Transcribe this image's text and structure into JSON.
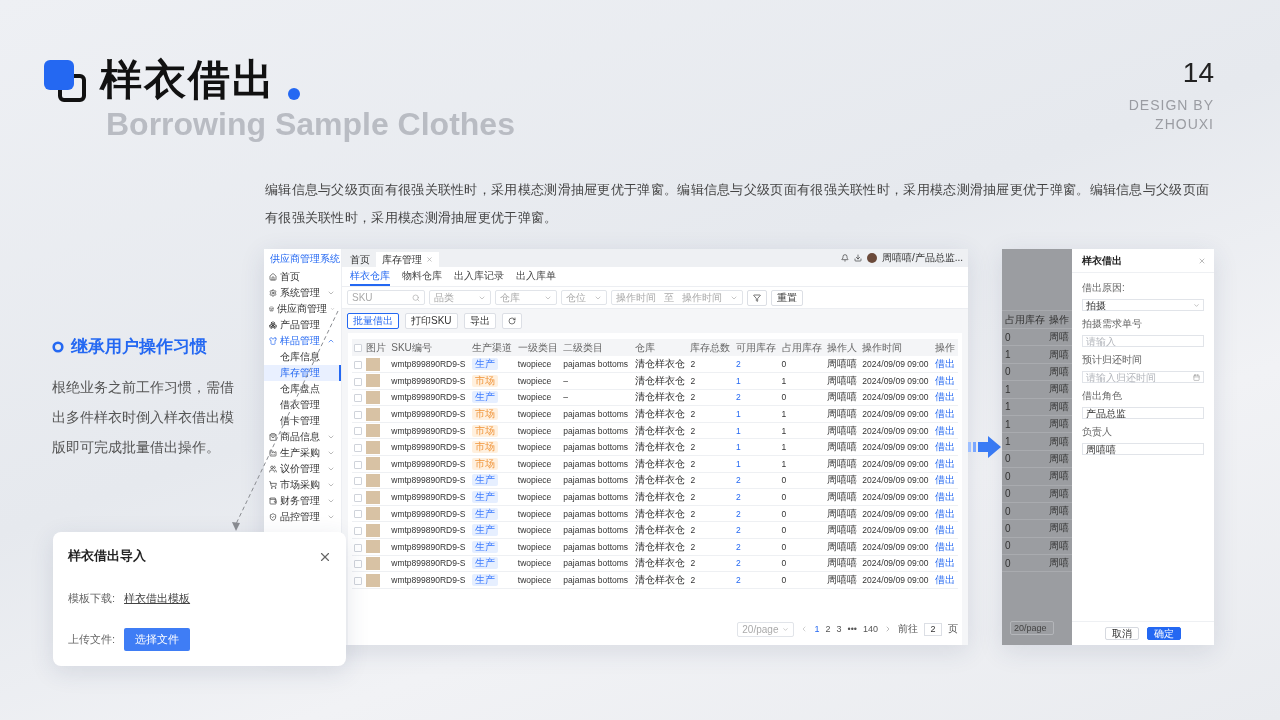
{
  "title": "样衣借出",
  "subtitle": "Borrowing Sample Clothes",
  "page_number": "14",
  "credit": [
    "DESIGN BY",
    "ZHOUXI"
  ],
  "description": "编辑信息与父级页面有很强关联性时，采用模态测滑抽屉更优于弹窗。编辑信息与父级页面有很强关联性时，采用模态测滑抽屉更优于弹窗。编辑信息与父级页面有很强关联性时，采用模态测滑抽屉更优于弹窗。",
  "feature": {
    "heading": "继承用户操作习惯",
    "text": "根绝业务之前工作习惯，需借出多件样衣时倒入样衣借出模版即可完成批量借出操作。"
  },
  "app": {
    "brand": "供应商管理系统",
    "sidebar": {
      "items": [
        {
          "label": "首页",
          "selected": false,
          "kind": "link"
        },
        {
          "label": "系统管理",
          "selected": false,
          "kind": "group",
          "expanded": false
        },
        {
          "label": "供应商管理",
          "selected": false,
          "kind": "group",
          "expanded": false
        },
        {
          "label": "产品管理",
          "selected": false,
          "kind": "link"
        },
        {
          "label": "样品管理",
          "selected": false,
          "kind": "group",
          "expanded": true,
          "children": [
            {
              "label": "仓库信息",
              "selected": false
            },
            {
              "label": "库存管理",
              "selected": true
            },
            {
              "label": "仓库盘点",
              "selected": false
            },
            {
              "label": "借衣管理",
              "selected": false
            },
            {
              "label": "借卡管理",
              "selected": false
            }
          ]
        },
        {
          "label": "商品信息",
          "selected": false,
          "kind": "group",
          "expanded": false
        },
        {
          "label": "生产采购",
          "selected": false,
          "kind": "group",
          "expanded": false
        },
        {
          "label": "议价管理",
          "selected": false,
          "kind": "group",
          "expanded": false
        },
        {
          "label": "市场采购",
          "selected": false,
          "kind": "group",
          "expanded": false
        },
        {
          "label": "财务管理",
          "selected": false,
          "kind": "group",
          "expanded": false
        },
        {
          "label": "品控管理",
          "selected": false,
          "kind": "group",
          "expanded": false
        }
      ]
    },
    "page_tabs": [
      {
        "label": "首页",
        "selected": false,
        "closable": false
      },
      {
        "label": "库存管理",
        "selected": true,
        "closable": true
      }
    ],
    "user": "周嘻嘻/产品总监...",
    "sub_tabs": [
      {
        "label": "样衣仓库",
        "selected": true
      },
      {
        "label": "物料仓库",
        "selected": false
      },
      {
        "label": "出入库记录",
        "selected": false
      },
      {
        "label": "出入库单",
        "selected": false
      }
    ],
    "filters": [
      {
        "kind": "search",
        "placeholder": "SKU"
      },
      {
        "kind": "select",
        "placeholder": "品类"
      },
      {
        "kind": "select",
        "placeholder": "仓库"
      },
      {
        "kind": "select",
        "placeholder": "仓位"
      },
      {
        "kind": "range",
        "placeholder": "操作时间",
        "separator": "至",
        "end_placeholder": "操作时间"
      }
    ],
    "reset_button": "重置",
    "actions": [
      {
        "label": "批量借出",
        "primary": true
      },
      {
        "label": "打印SKU",
        "primary": false
      },
      {
        "label": "导出",
        "primary": false
      }
    ],
    "table": {
      "all_checked": false,
      "columns": [
        "图片",
        "SKU编号",
        "生产渠道",
        "一级类目",
        "二级类目",
        "仓库",
        "库存总数",
        "可用库存",
        "占用库存",
        "操作人",
        "操作时间",
        "操作"
      ],
      "rows": [
        {
          "checked": false,
          "sku": "wmtp899890RD9-S",
          "channel": {
            "label": "生产",
            "kind": "production"
          },
          "cat1": "twopiece",
          "cat2": "pajamas bottoms",
          "warehouse": "清仓样衣仓",
          "total": "2",
          "available": "2",
          "occupied": "0",
          "operator": "周嘻嘻",
          "time": "2024/09/09 09:00",
          "action": "借出"
        },
        {
          "checked": false,
          "sku": "wmtp899890RD9-S",
          "channel": {
            "label": "市场",
            "kind": "market"
          },
          "cat1": "twopiece",
          "cat2": "–",
          "warehouse": "清仓样衣仓",
          "total": "2",
          "available": "1",
          "occupied": "1",
          "operator": "周嘻嘻",
          "time": "2024/09/09 09:00",
          "action": "借出"
        },
        {
          "checked": false,
          "sku": "wmtp899890RD9-S",
          "channel": {
            "label": "生产",
            "kind": "production"
          },
          "cat1": "twopiece",
          "cat2": "–",
          "warehouse": "清仓样衣仓",
          "total": "2",
          "available": "2",
          "occupied": "0",
          "operator": "周嘻嘻",
          "time": "2024/09/09 09:00",
          "action": "借出"
        },
        {
          "checked": false,
          "sku": "wmtp899890RD9-S",
          "channel": {
            "label": "市场",
            "kind": "market"
          },
          "cat1": "twopiece",
          "cat2": "pajamas bottoms",
          "warehouse": "清仓样衣仓",
          "total": "2",
          "available": "1",
          "occupied": "1",
          "operator": "周嘻嘻",
          "time": "2024/09/09 09:00",
          "action": "借出"
        },
        {
          "checked": false,
          "sku": "wmtp899890RD9-S",
          "channel": {
            "label": "市场",
            "kind": "market"
          },
          "cat1": "twopiece",
          "cat2": "pajamas bottoms",
          "warehouse": "清仓样衣仓",
          "total": "2",
          "available": "1",
          "occupied": "1",
          "operator": "周嘻嘻",
          "time": "2024/09/09 09:00",
          "action": "借出"
        },
        {
          "checked": false,
          "sku": "wmtp899890RD9-S",
          "channel": {
            "label": "市场",
            "kind": "market"
          },
          "cat1": "twopiece",
          "cat2": "pajamas bottoms",
          "warehouse": "清仓样衣仓",
          "total": "2",
          "available": "1",
          "occupied": "1",
          "operator": "周嘻嘻",
          "time": "2024/09/09 09:00",
          "action": "借出"
        },
        {
          "checked": false,
          "sku": "wmtp899890RD9-S",
          "channel": {
            "label": "市场",
            "kind": "market"
          },
          "cat1": "twopiece",
          "cat2": "pajamas bottoms",
          "warehouse": "清仓样衣仓",
          "total": "2",
          "available": "1",
          "occupied": "1",
          "operator": "周嘻嘻",
          "time": "2024/09/09 09:00",
          "action": "借出"
        },
        {
          "checked": false,
          "sku": "wmtp899890RD9-S",
          "channel": {
            "label": "生产",
            "kind": "production"
          },
          "cat1": "twopiece",
          "cat2": "pajamas bottoms",
          "warehouse": "清仓样衣仓",
          "total": "2",
          "available": "2",
          "occupied": "0",
          "operator": "周嘻嘻",
          "time": "2024/09/09 09:00",
          "action": "借出"
        },
        {
          "checked": false,
          "sku": "wmtp899890RD9-S",
          "channel": {
            "label": "生产",
            "kind": "production"
          },
          "cat1": "twopiece",
          "cat2": "pajamas bottoms",
          "warehouse": "清仓样衣仓",
          "total": "2",
          "available": "2",
          "occupied": "0",
          "operator": "周嘻嘻",
          "time": "2024/09/09 09:00",
          "action": "借出"
        },
        {
          "checked": false,
          "sku": "wmtp899890RD9-S",
          "channel": {
            "label": "生产",
            "kind": "production"
          },
          "cat1": "twopiece",
          "cat2": "pajamas bottoms",
          "warehouse": "清仓样衣仓",
          "total": "2",
          "available": "2",
          "occupied": "0",
          "operator": "周嘻嘻",
          "time": "2024/09/09 09:00",
          "action": "借出"
        },
        {
          "checked": false,
          "sku": "wmtp899890RD9-S",
          "channel": {
            "label": "生产",
            "kind": "production"
          },
          "cat1": "twopiece",
          "cat2": "pajamas bottoms",
          "warehouse": "清仓样衣仓",
          "total": "2",
          "available": "2",
          "occupied": "0",
          "operator": "周嘻嘻",
          "time": "2024/09/09 09:00",
          "action": "借出"
        },
        {
          "checked": false,
          "sku": "wmtp899890RD9-S",
          "channel": {
            "label": "生产",
            "kind": "production"
          },
          "cat1": "twopiece",
          "cat2": "pajamas bottoms",
          "warehouse": "清仓样衣仓",
          "total": "2",
          "available": "2",
          "occupied": "0",
          "operator": "周嘻嘻",
          "time": "2024/09/09 09:00",
          "action": "借出"
        },
        {
          "checked": false,
          "sku": "wmtp899890RD9-S",
          "channel": {
            "label": "生产",
            "kind": "production"
          },
          "cat1": "twopiece",
          "cat2": "pajamas bottoms",
          "warehouse": "清仓样衣仓",
          "total": "2",
          "available": "2",
          "occupied": "0",
          "operator": "周嘻嘻",
          "time": "2024/09/09 09:00",
          "action": "借出"
        },
        {
          "checked": false,
          "sku": "wmtp899890RD9-S",
          "channel": {
            "label": "生产",
            "kind": "production"
          },
          "cat1": "twopiece",
          "cat2": "pajamas bottoms",
          "warehouse": "清仓样衣仓",
          "total": "2",
          "available": "2",
          "occupied": "0",
          "operator": "周嘻嘻",
          "time": "2024/09/09 09:00",
          "action": "借出"
        }
      ]
    },
    "pagination": {
      "page_size": "20/page",
      "pages": [
        {
          "label": "1",
          "selected": true
        },
        {
          "label": "2",
          "selected": false
        },
        {
          "label": "3",
          "selected": false
        },
        {
          "label": "•••",
          "selected": false
        },
        {
          "label": "140",
          "selected": false
        }
      ],
      "goto_label": "前往",
      "goto_value": "2",
      "goto_suffix": "页"
    }
  },
  "drawer": {
    "mask": {
      "columns": [
        "占用库存",
        "操作"
      ],
      "rows": [
        {
          "occupied": "0",
          "operator": "周嘻"
        },
        {
          "occupied": "1",
          "operator": "周嘻"
        },
        {
          "occupied": "0",
          "operator": "周嘻"
        },
        {
          "occupied": "1",
          "operator": "周嘻"
        },
        {
          "occupied": "1",
          "operator": "周嘻"
        },
        {
          "occupied": "1",
          "operator": "周嘻"
        },
        {
          "occupied": "1",
          "operator": "周嘻"
        },
        {
          "occupied": "0",
          "operator": "周嘻"
        },
        {
          "occupied": "0",
          "operator": "周嘻"
        },
        {
          "occupied": "0",
          "operator": "周嘻"
        },
        {
          "occupied": "0",
          "operator": "周嘻"
        },
        {
          "occupied": "0",
          "operator": "周嘻"
        },
        {
          "occupied": "0",
          "operator": "周嘻"
        },
        {
          "occupied": "0",
          "operator": "周嘻"
        }
      ],
      "page_size": "20/page"
    },
    "title": "样衣借出",
    "fields": [
      {
        "label": "借出原因:",
        "kind": "select",
        "value": "拍摄"
      },
      {
        "label": "拍摄需求单号",
        "kind": "input",
        "placeholder": "请输入"
      },
      {
        "label": "预计归还时间",
        "kind": "date",
        "placeholder": "请输入归还时间"
      },
      {
        "label": "借出角色",
        "kind": "input",
        "value": "产品总监"
      },
      {
        "label": "负责人",
        "kind": "input",
        "value": "周嘻嘻"
      }
    ],
    "buttons": [
      {
        "label": "取消",
        "primary": false
      },
      {
        "label": "确定",
        "primary": true
      }
    ]
  },
  "dialog": {
    "title": "样衣借出导入",
    "template_label": "模板下载:",
    "template_link": "样衣借出模板",
    "upload_label": "上传文件:",
    "upload_button": "选择文件"
  }
}
